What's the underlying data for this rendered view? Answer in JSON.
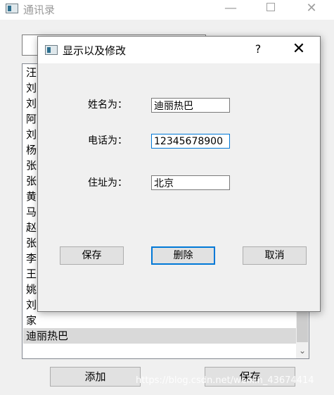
{
  "main_window": {
    "title": "通讯录",
    "controls": {
      "minimize": "—",
      "close": "✕"
    },
    "search_value": "",
    "list_items": [
      "汪",
      "刘",
      "刘",
      "阿",
      "刘",
      "杨",
      "张",
      "张",
      "黄",
      "马",
      "赵",
      "张",
      "李",
      "王",
      "姚",
      "刘",
      "家",
      "迪丽热巴"
    ],
    "selected_item": "迪丽热巴",
    "scroll_down_glyph": "⌄",
    "add_button": "添加",
    "save_button": "保存",
    "watermark": "https://blog.csdn.net/weixin_43674414"
  },
  "dialog": {
    "title": "显示以及修改",
    "help": "?",
    "close": "✕",
    "name_label": "姓名为：",
    "name_value": "迪丽热巴",
    "phone_label": "电话为：",
    "phone_value": "12345678900",
    "address_label": "住址为：",
    "address_value": "北京",
    "save_button": "保存",
    "delete_button": "删除",
    "cancel_button": "取消"
  },
  "colors": {
    "focus_accent": "#0078d7",
    "selection": "#d9d9d9",
    "window_bg": "#f0f0f0"
  }
}
